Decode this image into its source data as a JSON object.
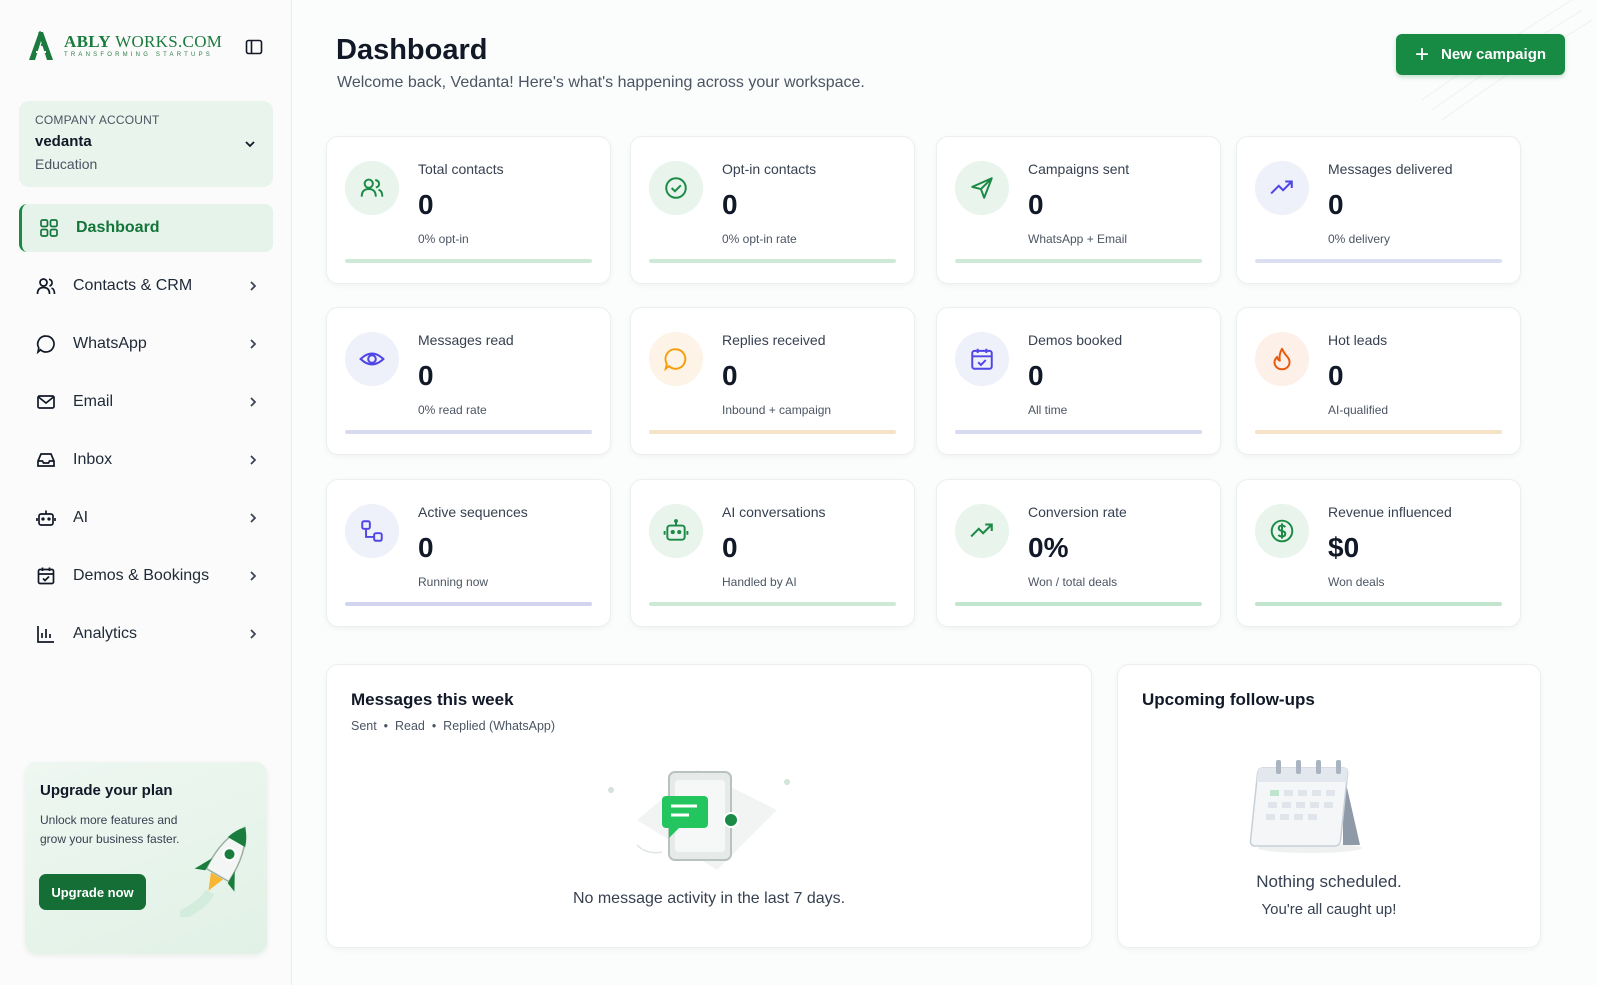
{
  "brand": {
    "name_bold": "ABLY",
    "name_rest": " WORKS.COM",
    "tagline": "TRANSFORMING STARTUPS",
    "accent": "#178a44"
  },
  "account": {
    "label": "COMPANY ACCOUNT",
    "name": "vedanta",
    "type": "Education"
  },
  "nav": [
    {
      "label": "Dashboard",
      "icon": "grid-icon",
      "active": true
    },
    {
      "label": "Contacts & CRM",
      "icon": "users-icon"
    },
    {
      "label": "WhatsApp",
      "icon": "chat-bubble-icon"
    },
    {
      "label": "Email",
      "icon": "mail-icon"
    },
    {
      "label": "Inbox",
      "icon": "inbox-icon"
    },
    {
      "label": "AI",
      "icon": "robot-icon"
    },
    {
      "label": "Demos & Bookings",
      "icon": "calendar-check-icon"
    },
    {
      "label": "Analytics",
      "icon": "bar-chart-icon"
    }
  ],
  "upgrade": {
    "title": "Upgrade your plan",
    "text": "Unlock more features and grow your business faster.",
    "button": "Upgrade now"
  },
  "header": {
    "title": "Dashboard",
    "subtitle": "Welcome back, Vedanta! Here's what's happening across your workspace.",
    "new_campaign": "New campaign"
  },
  "stats": [
    {
      "label": "Total contacts",
      "value": "0",
      "sub": "0% opt-in",
      "icon": "users-icon",
      "color": "#1a8a45",
      "bg": "#e8f4ec",
      "bar": "#cfe9d7"
    },
    {
      "label": "Opt-in contacts",
      "value": "0",
      "sub": "0% opt-in rate",
      "icon": "check-circle-icon",
      "color": "#1a8a45",
      "bg": "#e8f4ec",
      "bar": "#cfe9d7"
    },
    {
      "label": "Campaigns sent",
      "value": "0",
      "sub": "WhatsApp + Email",
      "icon": "send-icon",
      "color": "#1a8a45",
      "bg": "#e8f4ec",
      "bar": "#cfe9d7"
    },
    {
      "label": "Messages delivered",
      "value": "0",
      "sub": "0% delivery",
      "icon": "trending-up-icon",
      "color": "#4f46e5",
      "bg": "#eef0fa",
      "bar": "#dcdff2"
    },
    {
      "label": "Messages read",
      "value": "0",
      "sub": "0% read rate",
      "icon": "eye-icon",
      "color": "#4f46e5",
      "bg": "#eef0fa",
      "bar": "#d8dbef"
    },
    {
      "label": "Replies received",
      "value": "0",
      "sub": "Inbound + campaign",
      "icon": "chat-bubble-icon",
      "color": "#f59e0b",
      "bg": "#fdf3e6",
      "bar": "#f6e2c6"
    },
    {
      "label": "Demos booked",
      "value": "0",
      "sub": "All time",
      "icon": "calendar-check-icon",
      "color": "#4f46e5",
      "bg": "#eef0fa",
      "bar": "#d8dbef"
    },
    {
      "label": "Hot leads",
      "value": "0",
      "sub": "AI-qualified",
      "icon": "flame-icon",
      "color": "#ea580c",
      "bg": "#fdf0e8",
      "bar": "#f6e2c6"
    },
    {
      "label": "Active sequences",
      "value": "0",
      "sub": "Running now",
      "icon": "workflow-icon",
      "color": "#4f46e5",
      "bg": "#eef0fa",
      "bar": "#d2d5ef"
    },
    {
      "label": "AI conversations",
      "value": "0",
      "sub": "Handled by AI",
      "icon": "robot-icon",
      "color": "#1a8a45",
      "bg": "#e8f4ec",
      "bar": "#cfe9d7"
    },
    {
      "label": "Conversion rate",
      "value": "0%",
      "sub": "Won / total deals",
      "icon": "trending-up-icon",
      "color": "#1a8a45",
      "bg": "#e8f4ec",
      "bar": "#c3e5cd"
    },
    {
      "label": "Revenue influenced",
      "value": "$0",
      "sub": "Won deals",
      "icon": "dollar-circle-icon",
      "color": "#1a8a45",
      "bg": "#e8f4ec",
      "bar": "#c3e5cd"
    }
  ],
  "messages_panel": {
    "title": "Messages this week",
    "legend": [
      "Sent",
      "Read",
      "Replied (WhatsApp)"
    ],
    "empty": "No message activity in the last 7 days."
  },
  "followups_panel": {
    "title": "Upcoming follow-ups",
    "empty_line1": "Nothing scheduled.",
    "empty_line2": "You're all caught up!"
  }
}
